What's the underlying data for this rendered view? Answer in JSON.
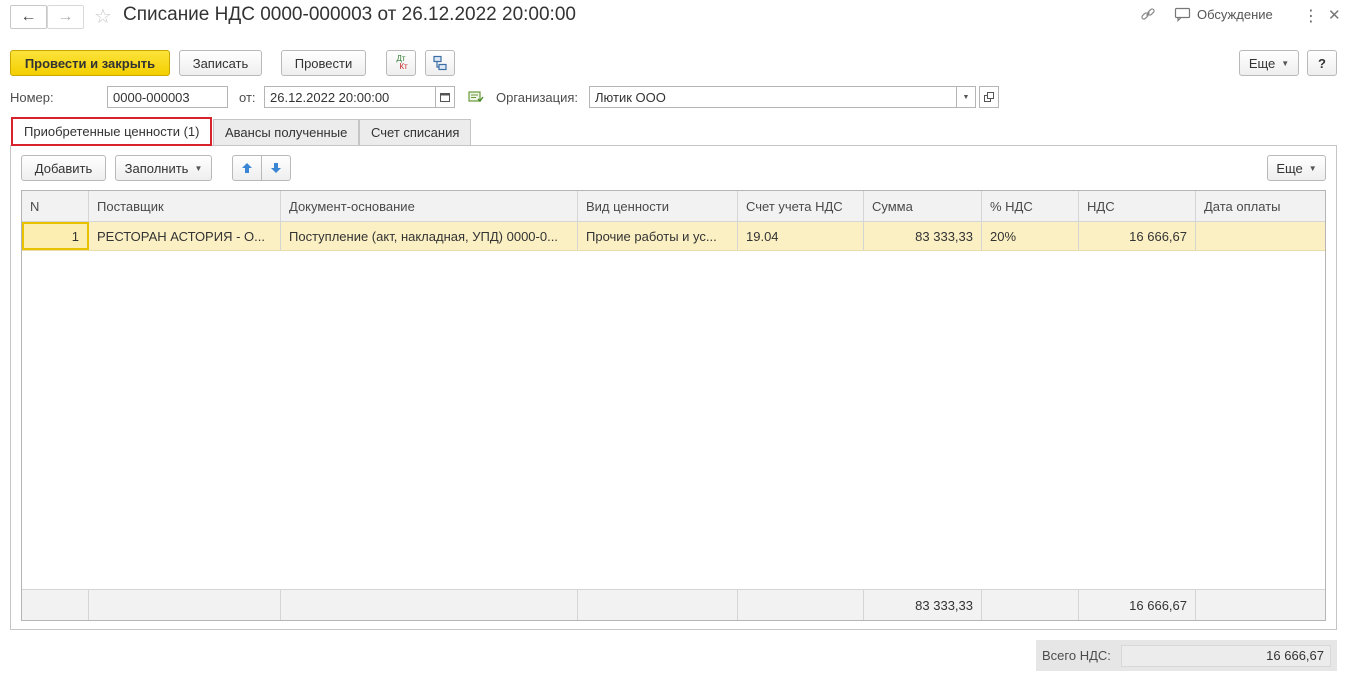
{
  "window": {
    "title": "Списание НДС 0000-000003 от 26.12.2022 20:00:00",
    "discussion_label": "Обсуждение"
  },
  "toolbar": {
    "post_close_label": "Провести и закрыть",
    "save_label": "Записать",
    "post_label": "Провести",
    "dtkt_icon_text": "Дт Кт",
    "more_label": "Еще",
    "help_label": "?"
  },
  "form": {
    "number_label": "Номер:",
    "number_value": "0000-000003",
    "date_label": "от:",
    "date_value": "26.12.2022 20:00:00",
    "org_label": "Организация:",
    "org_value": "Лютик ООО"
  },
  "tabs": [
    {
      "label": "Приобретенные ценности (1)",
      "active": true
    },
    {
      "label": "Авансы полученные",
      "active": false
    },
    {
      "label": "Счет списания",
      "active": false
    }
  ],
  "table_toolbar": {
    "add_label": "Добавить",
    "fill_label": "Заполнить",
    "more_label": "Еще"
  },
  "table": {
    "columns": [
      "N",
      "Поставщик",
      "Документ-основание",
      "Вид ценности",
      "Счет учета НДС",
      "Сумма",
      "% НДС",
      "НДС",
      "Дата оплаты"
    ],
    "rows": [
      [
        "1",
        "РЕСТОРАН АСТОРИЯ - О...",
        "Поступление (акт, накладная, УПД) 0000-0...",
        "Прочие работы и ус...",
        "19.04",
        "83 333,33",
        "20%",
        "16 666,67",
        ""
      ]
    ],
    "footer": [
      "",
      "",
      "",
      "",
      "",
      "83 333,33",
      "",
      "16 666,67",
      ""
    ]
  },
  "totals": {
    "vat_total_label": "Всего НДС:",
    "vat_total_value": "16 666,67"
  },
  "icons": {
    "back": "arrow-left-icon",
    "forward": "arrow-right-icon",
    "favorite": "star-icon",
    "link": "link-icon",
    "discussion": "chat-icon",
    "menu": "kebab-icon",
    "close": "close-icon"
  },
  "colors": {
    "primary_button": "#f4cf00",
    "selected_row": "#fbf0c4",
    "active_tab_border": "#d7232b"
  }
}
